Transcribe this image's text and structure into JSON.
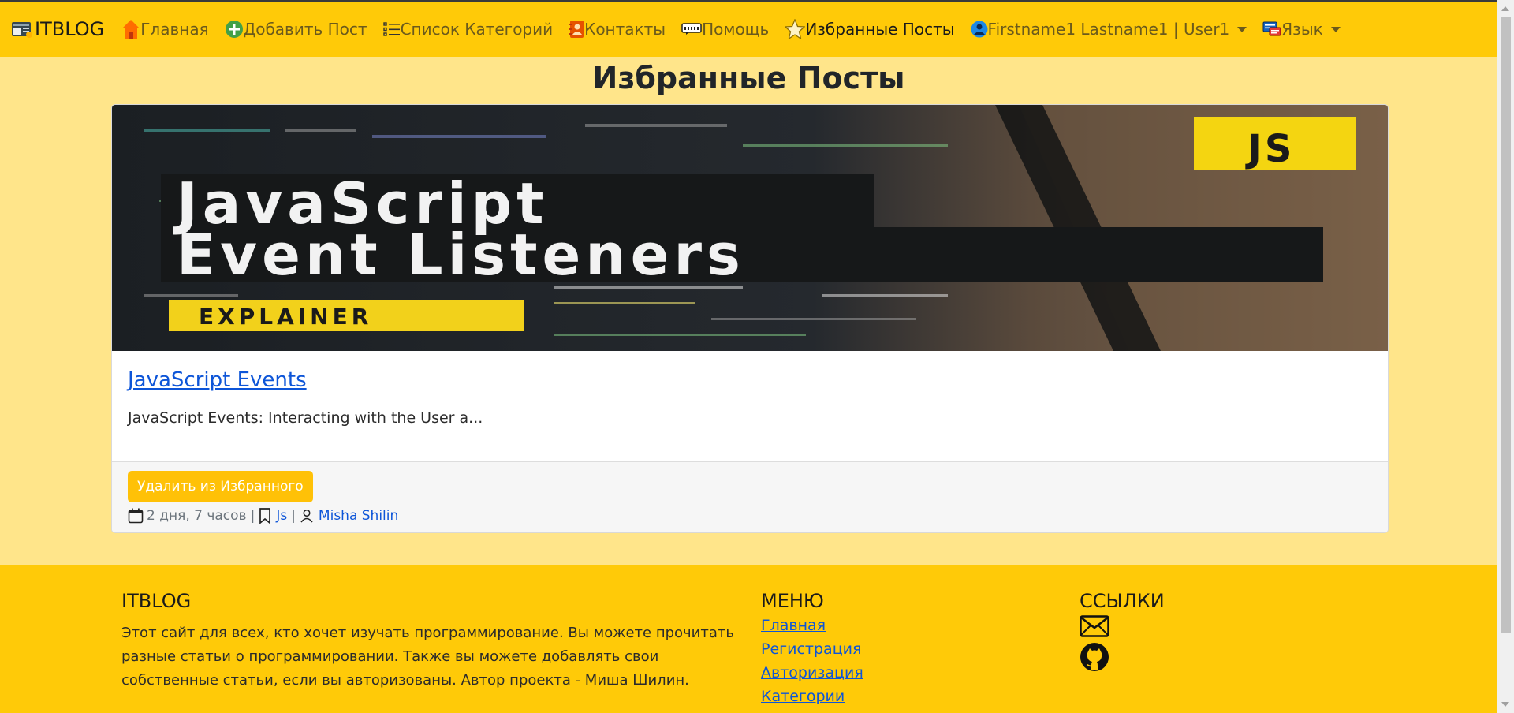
{
  "navbar": {
    "brand": "ITBLOG",
    "items": [
      {
        "label": "Главная",
        "icon": "home-icon"
      },
      {
        "label": "Добавить Пост",
        "icon": "add-circle-icon"
      },
      {
        "label": "Список Категорий",
        "icon": "list-icon"
      },
      {
        "label": "Контакты",
        "icon": "contacts-book-icon"
      },
      {
        "label": "Помощь",
        "icon": "help-icon"
      },
      {
        "label": "Избранные Посты",
        "icon": "star-icon"
      },
      {
        "label": "Firstname1 Lastname1 | User1",
        "icon": "user-avatar-icon"
      },
      {
        "label": "Язык",
        "icon": "language-chat-icon"
      }
    ]
  },
  "page": {
    "title": "Избранные Посты"
  },
  "post": {
    "image": {
      "line1": "JavaScript",
      "line2": "Event Listeners",
      "tag": "EXPLAINER",
      "badge": "JS"
    },
    "title": "JavaScript Events",
    "excerpt": "JavaScript Events: Interacting with the User a...",
    "button": "Удалить из Избранного",
    "date": "2 дня, 7 часов",
    "category": "Js",
    "author": "Misha Shilin",
    "separator": "|"
  },
  "footer": {
    "about": {
      "title": "ITBLOG",
      "text": "Этот сайт для всех, кто хочет изучать программирование. Вы можете прочитать разные статьи о программировании. Также вы можете добавлять свои собственные статьи, если вы авторизованы. Автор проекта - Миша Шилин."
    },
    "menu": {
      "title": "МЕНЮ",
      "links": [
        "Главная",
        "Регистрация",
        "Авторизация",
        "Категории"
      ]
    },
    "links": {
      "title": "ССЫЛКИ"
    }
  },
  "colors": {
    "navbar": "#ffca08",
    "background": "#ffe58a",
    "link": "#0d55d8",
    "button": "#ffc107"
  }
}
